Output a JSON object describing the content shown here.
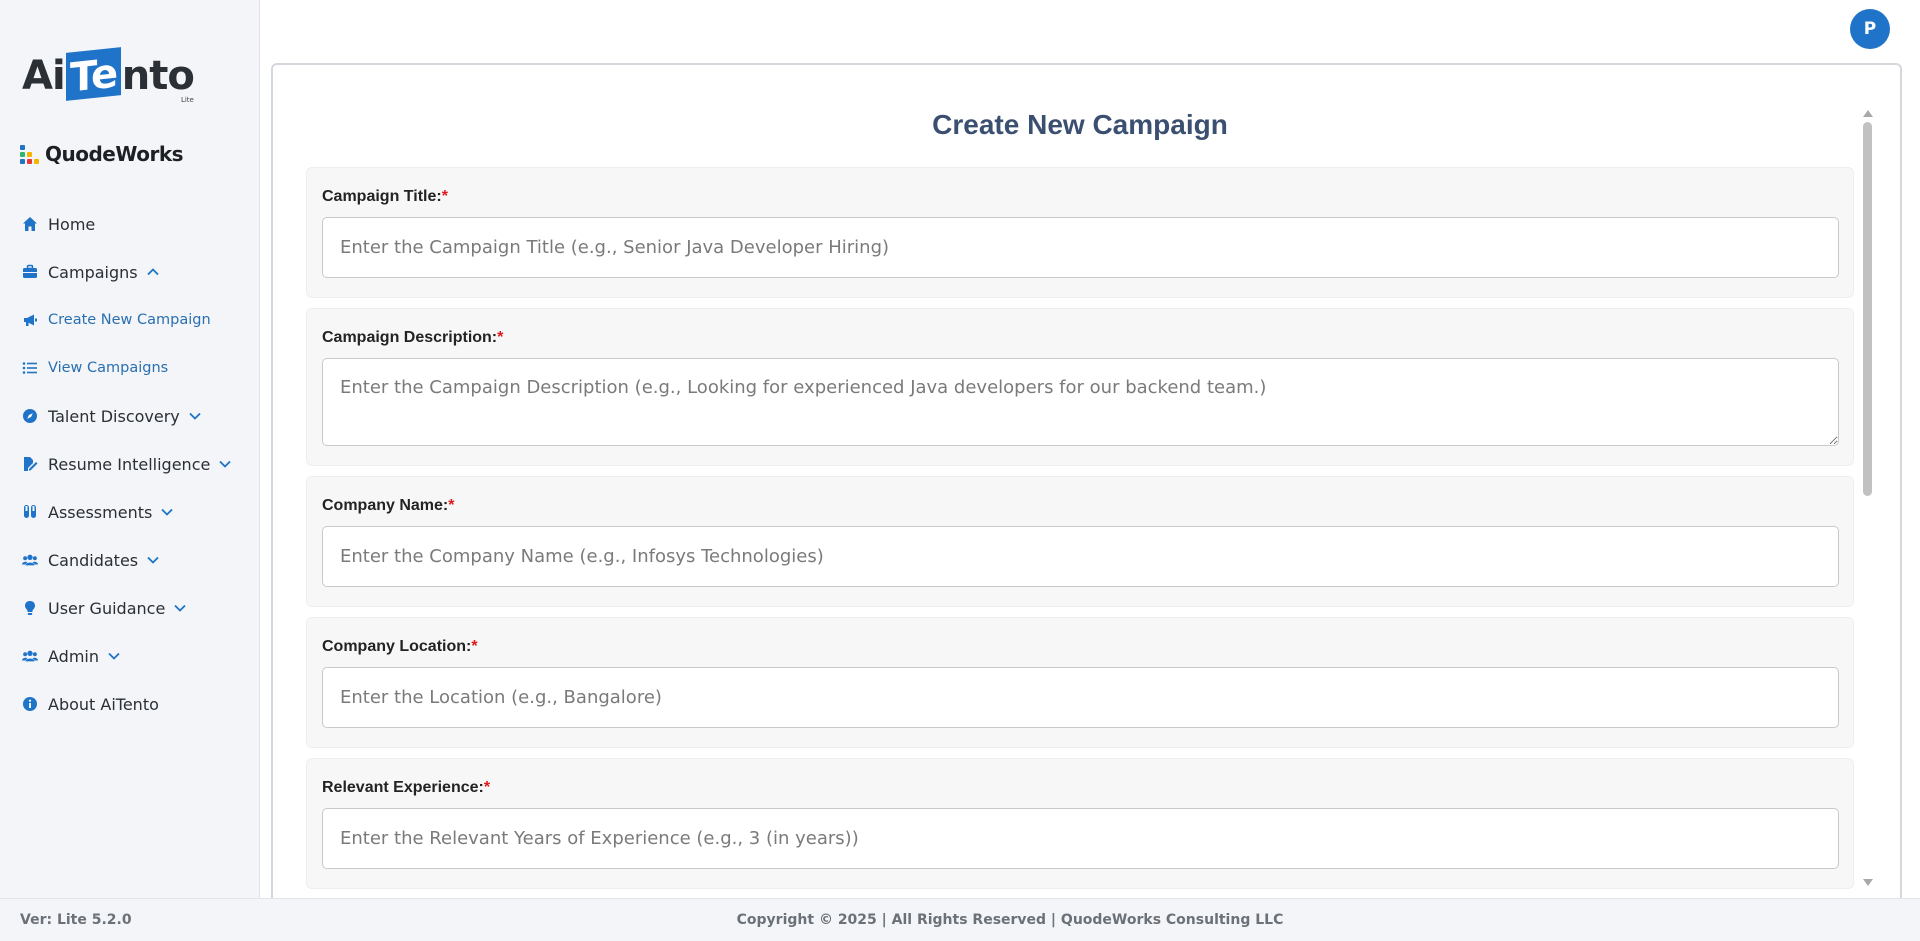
{
  "app": {
    "logo_text_before": "Ai",
    "logo_text_highlight": "Te",
    "logo_text_after": "nto",
    "logo_tag": "Lite",
    "brand_name": "QuodeWorks",
    "user_initial": "P"
  },
  "colors": {
    "accent": "#1f73c8",
    "title": "#3b5070",
    "required": "#e01818",
    "sidebar_bg": "#f3f5f8"
  },
  "sidebar": {
    "items": [
      {
        "label": "Home",
        "icon": "home-icon"
      },
      {
        "label": "Campaigns",
        "icon": "briefcase-icon",
        "chevron": "up"
      },
      {
        "label": "Create New Campaign",
        "icon": "megaphone-icon",
        "sub": true
      },
      {
        "label": "View Campaigns",
        "icon": "list-icon",
        "sub": true
      },
      {
        "label": "Talent Discovery",
        "icon": "compass-icon",
        "chevron": "down"
      },
      {
        "label": "Resume Intelligence",
        "icon": "file-signature-icon",
        "chevron": "down"
      },
      {
        "label": "Assessments",
        "icon": "vials-icon",
        "chevron": "down"
      },
      {
        "label": "Candidates",
        "icon": "users-icon",
        "chevron": "down"
      },
      {
        "label": "User Guidance",
        "icon": "lightbulb-icon",
        "chevron": "down"
      },
      {
        "label": "Admin",
        "icon": "users-cog-icon",
        "chevron": "down"
      },
      {
        "label": "About AiTento",
        "icon": "info-icon"
      }
    ]
  },
  "main": {
    "title": "Create New Campaign",
    "fields": [
      {
        "label": "Campaign Title:",
        "required": "*",
        "placeholder": "Enter the Campaign Title (e.g., Senior Java Developer Hiring)",
        "type": "input"
      },
      {
        "label": "Campaign Description:",
        "required": "*",
        "placeholder": "Enter the Campaign Description (e.g., Looking for experienced Java developers for our backend team.)",
        "type": "textarea"
      },
      {
        "label": "Company Name:",
        "required": "*",
        "placeholder": "Enter the Company Name (e.g., Infosys Technologies)",
        "type": "input"
      },
      {
        "label": "Company Location:",
        "required": "*",
        "placeholder": "Enter the Location (e.g., Bangalore)",
        "type": "input"
      },
      {
        "label": "Relevant Experience:",
        "required": "*",
        "placeholder": "Enter the Relevant Years of Experience (e.g., 3 (in years))",
        "type": "input"
      }
    ]
  },
  "footer": {
    "version": "Ver: Lite 5.2.0",
    "copyright": "Copyright © 2025 | All Rights Reserved | QuodeWorks Consulting LLC"
  }
}
